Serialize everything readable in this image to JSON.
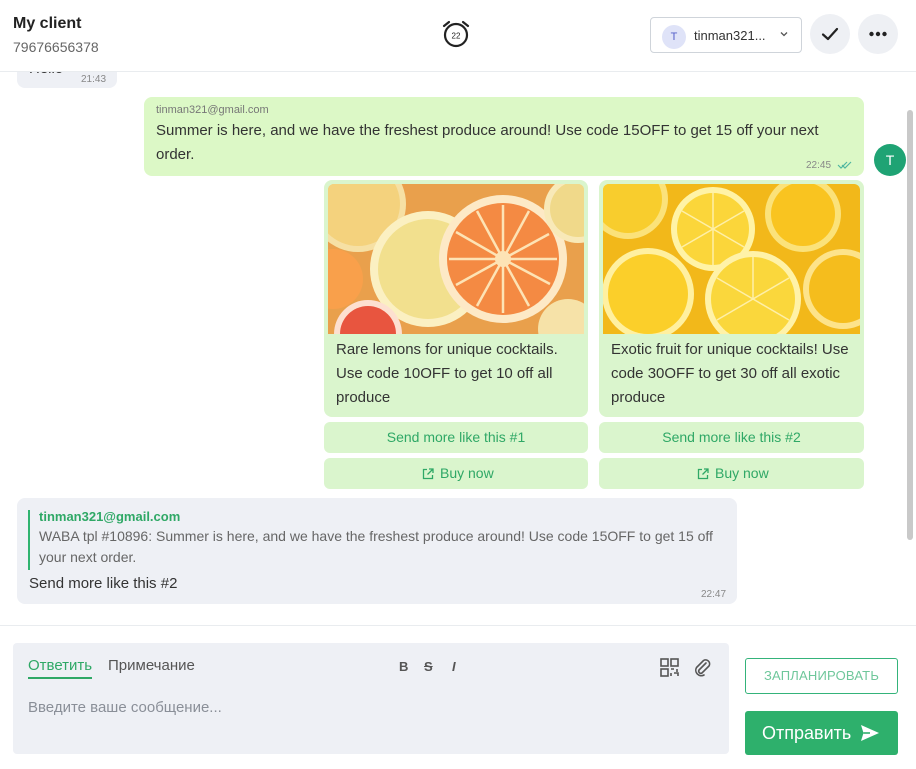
{
  "header": {
    "client_name": "My client",
    "client_phone": "79676656378",
    "timer_value": "22",
    "agent_initial": "T",
    "agent_name": "tinman321...",
    "icons": {
      "timer": "alarm-clock-icon",
      "check": "check-icon",
      "more": "more-dots-icon",
      "chevron": "chevron-down-icon"
    }
  },
  "messages": {
    "prev": {
      "text": "Hello",
      "time": "21:43"
    },
    "outgoing": {
      "sender": "tinman321@gmail.com",
      "text": "Summer is here, and we have the freshest produce around! Use code 15OFF to get 15 off your next order.",
      "time": "22:45",
      "avatar_initial": "T",
      "status": "double-check-read-icon"
    },
    "cards": [
      {
        "text": "Rare lemons for unique cocktails. Use code 10OFF to get 10 off all produce",
        "quick_reply": "Send more like this #1",
        "link": "Buy now"
      },
      {
        "text": "Exotic fruit for unique cocktails! Use code 30OFF to get 30 off all exotic produce",
        "quick_reply": "Send more like this #2",
        "link": "Buy now"
      }
    ],
    "reply": {
      "quoted_sender": "tinman321@gmail.com",
      "quoted_text": "WABA tpl #10896: Summer is here, and we have the freshest produce around! Use code 15OFF to get 15 off your next order.",
      "text": "Send more like this #2",
      "time": "22:47"
    }
  },
  "composer": {
    "tab_reply": "Ответить",
    "tab_note": "Примечание",
    "format": {
      "bold": "B",
      "strike": "S",
      "italic": "I"
    },
    "placeholder": "Введите ваше сообщение...",
    "schedule_label": "ЗАПЛАНИРОВАТЬ",
    "send_label": "Отправить"
  },
  "colors": {
    "accent": "#2eb06c",
    "outgoing_bubble": "#dcf8c6",
    "incoming_bubble": "#eef0f5"
  }
}
